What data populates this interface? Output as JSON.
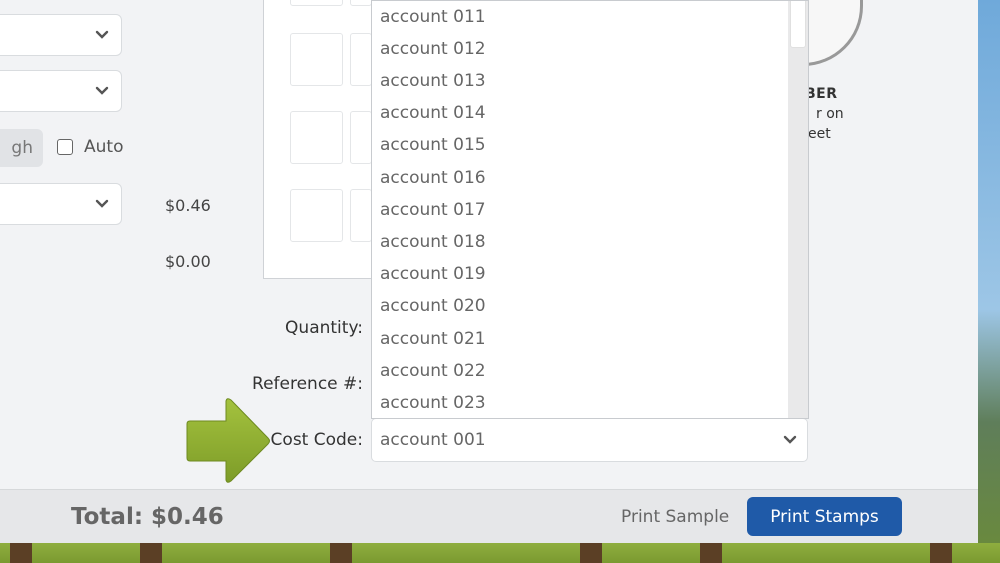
{
  "left_panel": {
    "pill_text": "gh",
    "auto_label": "Auto",
    "price_1": "$0.46",
    "price_2": "$0.00"
  },
  "seal": {
    "line1": "BER",
    "line2": "r on",
    "line3": "eet"
  },
  "form": {
    "quantity_label": "Quantity:",
    "reference_label": "Reference #:",
    "cost_code_label": "Cost Code:",
    "cost_code_value": "account 001"
  },
  "dropdown": {
    "options": [
      "account 011",
      "account 012",
      "account 013",
      "account 014",
      "account 015",
      "account 016",
      "account 017",
      "account 018",
      "account 019",
      "account 020",
      "account 021",
      "account 022",
      "account 023"
    ]
  },
  "footer": {
    "total": "Total: $0.46",
    "print_sample": "Print Sample",
    "print_stamps": "Print Stamps"
  },
  "colors": {
    "primary_button": "#1f5aa8",
    "arrow": "#8fb031"
  }
}
